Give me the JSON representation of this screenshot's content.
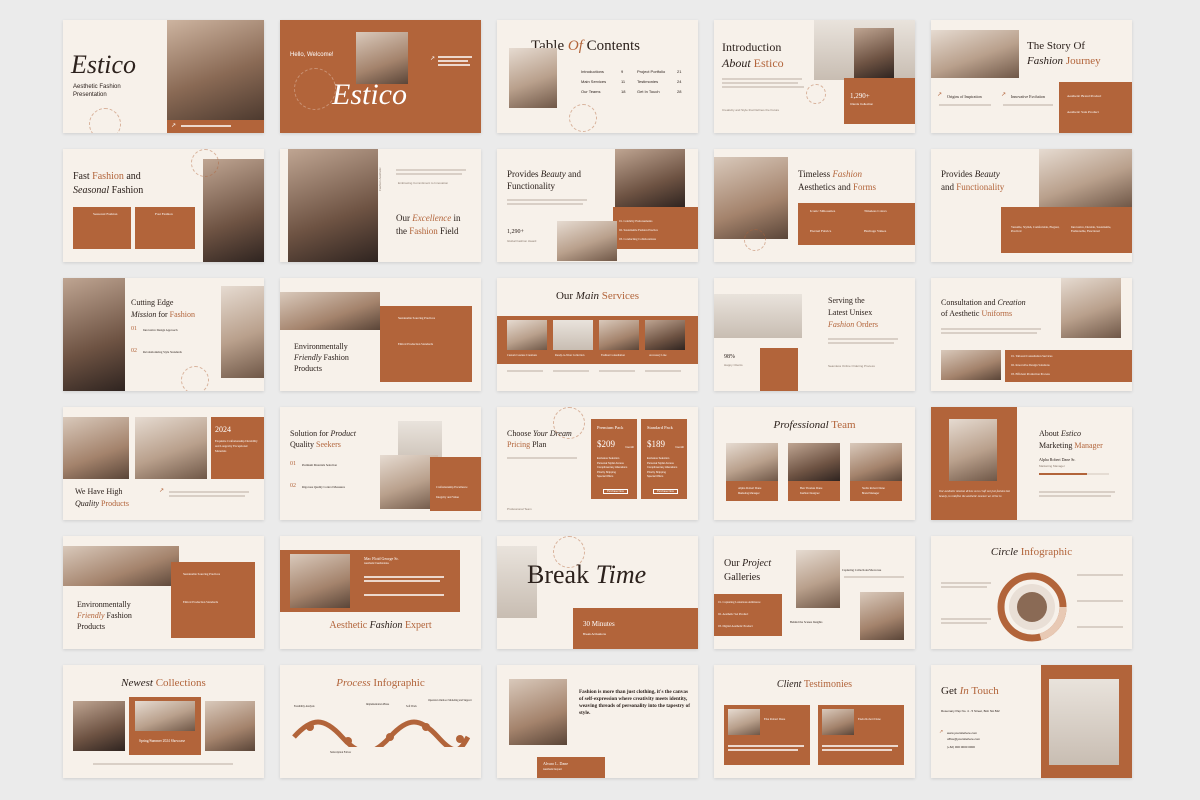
{
  "colors": {
    "brand": "#b2643a",
    "background": "#f7f1ea",
    "page": "#ebebeb",
    "text": "#2c211c"
  },
  "s01": {
    "title": "Estico",
    "subtitle": "Aesthetic Fashion Presentation"
  },
  "s02": {
    "greeting": "Hello, Welcome!",
    "title": "Estico"
  },
  "s03": {
    "title_a": "Table ",
    "title_b": "Of ",
    "title_c": "Contents",
    "items": [
      {
        "label": "Introductions",
        "num": "9"
      },
      {
        "label": "Main Services",
        "num": "11"
      },
      {
        "label": "Our Teams",
        "num": "18"
      },
      {
        "label": "Project Portfolio",
        "num": "21"
      },
      {
        "label": "Testimonies",
        "num": "24"
      },
      {
        "label": "Get In Touch",
        "num": "28"
      }
    ]
  },
  "s04": {
    "title_a": "Introduction",
    "title_b": "About ",
    "title_c": "Estico",
    "stat": "1,290+",
    "stat_label": "Clients Collection",
    "footer": "Creativity and Style that Defines the Future"
  },
  "s05": {
    "title_a": "The Story Of",
    "title_b": "Fashion ",
    "title_c": "Journey",
    "items": [
      "Origins of Inspiration",
      "Innovative Evolution",
      "Aesthetic Brand Product",
      "Aesthetic Sale Product"
    ]
  },
  "s06": {
    "title_a": "Fast ",
    "title_b": "Fashion",
    "title_c": " and",
    "title_d": "Seasonal",
    "title_e": " Fashion",
    "b1": "Seasonal Fashion",
    "b2": "Fast Fashion"
  },
  "s07": {
    "tag": "Embracing Commitment to Innovation",
    "title_a": "Our ",
    "title_b": "Excellence",
    "title_c": " in",
    "title_d": "the ",
    "title_e": "Fashion",
    "title_f": " Field",
    "side": "Fashion Aesthetic"
  },
  "s08": {
    "title_a": "Provides ",
    "title_b": "Beauty",
    "title_c": " and",
    "title_d": "Functionality",
    "stat": "1,290+",
    "stat_label": "Global Fashion Award",
    "items": [
      "01. Celebrity Endorsements",
      "02. Sustainable Fashion Practice",
      "03. Conducting Collaborations"
    ]
  },
  "s09": {
    "title_a": "Timeless ",
    "title_b": "Fashion",
    "title_c": "Aesthetics and ",
    "title_d": "Forms",
    "items": [
      "Iconic Silhouettes",
      "Timeless Colors",
      "Eternal Fabrics",
      "Heritage Values"
    ]
  },
  "s10": {
    "title_a": "Provides ",
    "title_b": "Beauty",
    "title_c": "and ",
    "title_d": "Functionality",
    "items": [
      "Versatile, Stylish, Comfortable, Elegant, Practical",
      "Innovative, Durable, Sustainable, Fashionable, Functional"
    ]
  },
  "s11": {
    "title_a": "Cutting Edge",
    "title_b": "Mission",
    "title_c": " for ",
    "title_d": "Fashion",
    "n1": "01",
    "i1": "Innovative Design Approach",
    "n2": "02",
    "i2": "Revolutionizing Style Standards"
  },
  "s12": {
    "title_a": "Environmentally",
    "title_b": "Friendly",
    "title_c": " Fashion",
    "title_d": "Products",
    "i1": "Sustainable Sourcing Practices",
    "i2": "Ethical Production Standards"
  },
  "s13": {
    "title_a": "Our ",
    "title_b": "Main",
    "title_c": " Services",
    "services": [
      "Custom Couture Creations",
      "Ready-to-Wear Collection",
      "Fashion Consultation",
      "Accessory Line"
    ]
  },
  "s14": {
    "title_a": "Serving the",
    "title_b": "Latest Unisex",
    "title_c": "Fashion",
    "title_d": " Orders",
    "stat": "98%",
    "stat_label": "Happy Clients",
    "footer": "Seamless Online Ordering Process"
  },
  "s15": {
    "title_a": "Consultation and ",
    "title_b": "Creation",
    "title_c": "of Aesthetic ",
    "title_d": "Uniforms",
    "items": [
      "01. Tailored Consultation Services",
      "02. Innovative Design Solutions",
      "03. Efficient Production Process"
    ]
  },
  "s16": {
    "year": "2024",
    "sub": "Exquisite Craftsmanship Durability and Longevity Exceptional Materials",
    "title_a": "We Have High",
    "title_b": "Quality",
    "title_c": " Products"
  },
  "s17": {
    "title_a": "Solution for ",
    "title_b": "Product",
    "title_c": "Quality ",
    "title_d": "Seekers",
    "i1": "Premium Materials Selection",
    "i2": "Rigorous Quality Control Measures",
    "b1": "Craftsmanship Excellence",
    "b2": "Integrity and Value"
  },
  "s18": {
    "title_a": "Choose ",
    "title_b": "Your Dream",
    "title_c": "Pricing",
    "title_d": " Plan",
    "p1": "Premium Pack",
    "price1": "$209",
    "p2": "Standard Pack",
    "price2": "$189",
    "per": "/month",
    "features": [
      "Exclusive Selection",
      "Personal Stylist Access",
      "Complimentary Alterations",
      "Priority Shipping",
      "Special Offers"
    ],
    "btn": "Purchase Now",
    "footer": "Professional Team"
  },
  "s19": {
    "title_a": "Professional",
    "title_b": " Team",
    "members": [
      {
        "name": "Alpha Robert Dane",
        "role": "Marketing Manager"
      },
      {
        "name": "Ben Thomas Dane",
        "role": "Fashion Designer"
      },
      {
        "name": "Stella Robert Dane",
        "role": "Brand Manager"
      }
    ]
  },
  "s20": {
    "title_a": "About ",
    "title_b": "Estico",
    "title_c": "Marketing ",
    "title_d": "Manager",
    "name": "Alpha Robert Dane Sr.",
    "role": "Marketing Manager",
    "quote": "Our aesthetic mission drives us to craft not just fashion but beauty, to redefine the aesthetic essence we strive to"
  },
  "s21": {
    "title_a": "Environmentally",
    "title_b": "Friendly",
    "title_c": " Fashion",
    "title_d": "Products",
    "i1": "Sustainable Sourcing Practices",
    "i2": "Ethical Production Standards"
  },
  "s22": {
    "name": "Mac Floid George Sr.",
    "role": "Aesthetic Fashionista",
    "title_a": "Aesthetic ",
    "title_b": "Fashion",
    "title_c": " Expert"
  },
  "s23": {
    "title_a": "Break ",
    "title_b": "Time",
    "duration": "30 Minutes",
    "sub": "Break Activations"
  },
  "s24": {
    "title_a": "Our ",
    "title_b": "Project",
    "title_c": "Galleries",
    "items": [
      "01. Capturing Luxurious Ambiance",
      "02. Aesthetic Set Product",
      "03. Digital Aesthetic Product"
    ],
    "t1": "Capturing Collections/Showcase",
    "t2": "Behind the Scenes Insights"
  },
  "s25": {
    "title_a": "Circle ",
    "title_b": "Infographic"
  },
  "s26": {
    "title_a": "Newest",
    "title_b": " Collections",
    "caption": "Spring/Summer 2024 Showcase"
  },
  "s27": {
    "title_a": "Process ",
    "title_b": "Infographic",
    "steps": [
      "Feasibility Analysis",
      "Subscription Follow",
      "Implementation Phase",
      "Soft Work",
      "Operation Outdoor Modeling and Support"
    ]
  },
  "s28": {
    "quote": "Fashion is more than just clothing, it's the canvas of self-expression where creativity meets identity, weaving threads of personality into the tapestry of style.",
    "name": "Alvaro L. Dane",
    "role": "Aesthetic Expert"
  },
  "s29": {
    "title_a": "Client ",
    "title_b": "Testimonies",
    "c1": "Elsa Robert Dane",
    "c2": "Ezela Robert Dane"
  },
  "s30": {
    "title_a": "Get ",
    "title_b": "In",
    "title_c": " Touch",
    "address": "Rosemary Pap No. 4 - 5 Street, Bob NA 842",
    "web": "www.yoursitehere.com",
    "mail": "office@yoursitehere.com",
    "phone": "(+62) 000 0000 0000"
  }
}
